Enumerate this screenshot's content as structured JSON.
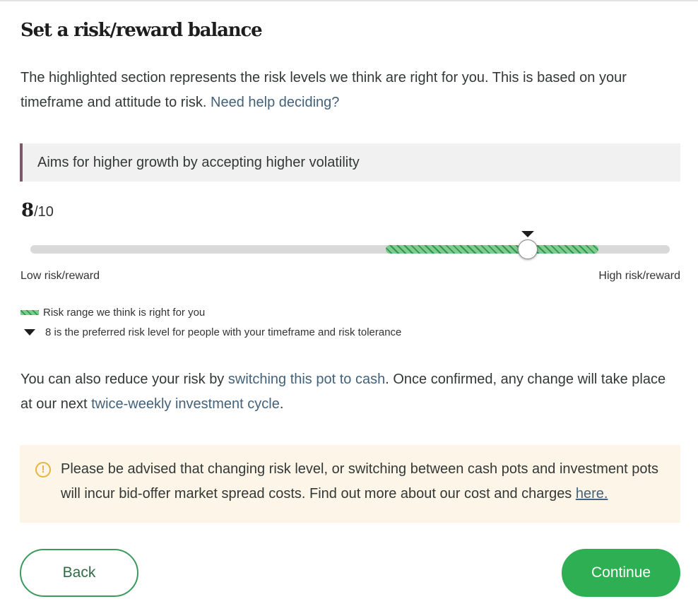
{
  "header": {
    "title": "Set a risk/reward balance"
  },
  "intro": {
    "text": "The highlighted section represents the risk levels we think are right for you. This is based on your timeframe and attitude to risk. ",
    "help_link": "Need help deciding?"
  },
  "description": "Aims for higher growth by accepting higher volatility",
  "score": {
    "value": "8",
    "max_label": "/10"
  },
  "slider": {
    "min": 1,
    "max": 10,
    "value": 8,
    "recommended_range": [
      6,
      9
    ],
    "preferred": 8,
    "low_label": "Low risk/reward",
    "high_label": "High risk/reward"
  },
  "legend": {
    "range_label": "Risk range we think is right for you",
    "preferred_label": "8 is the preferred risk level for people with your timeframe and risk tolerance"
  },
  "cash_info": {
    "text1": "You can also reduce your risk by ",
    "link1": "switching this pot to cash",
    "text2": ". Once confirmed, any change will take place at our next ",
    "link2": "twice-weekly investment cycle",
    "text3": "."
  },
  "warning": {
    "icon": "!",
    "text": "Please be advised that changing risk level, or switching between cash pots and investment pots will incur bid-offer market spread costs. Find out more about our cost and charges ",
    "link": "here."
  },
  "buttons": {
    "back": "Back",
    "continue": "Continue"
  },
  "colors": {
    "primary_green": "#2faf53",
    "link_blue": "#43627a",
    "accent_plum": "#7e5768",
    "warning_amber": "#e7b53f",
    "warning_bg": "#fdf5e7"
  }
}
